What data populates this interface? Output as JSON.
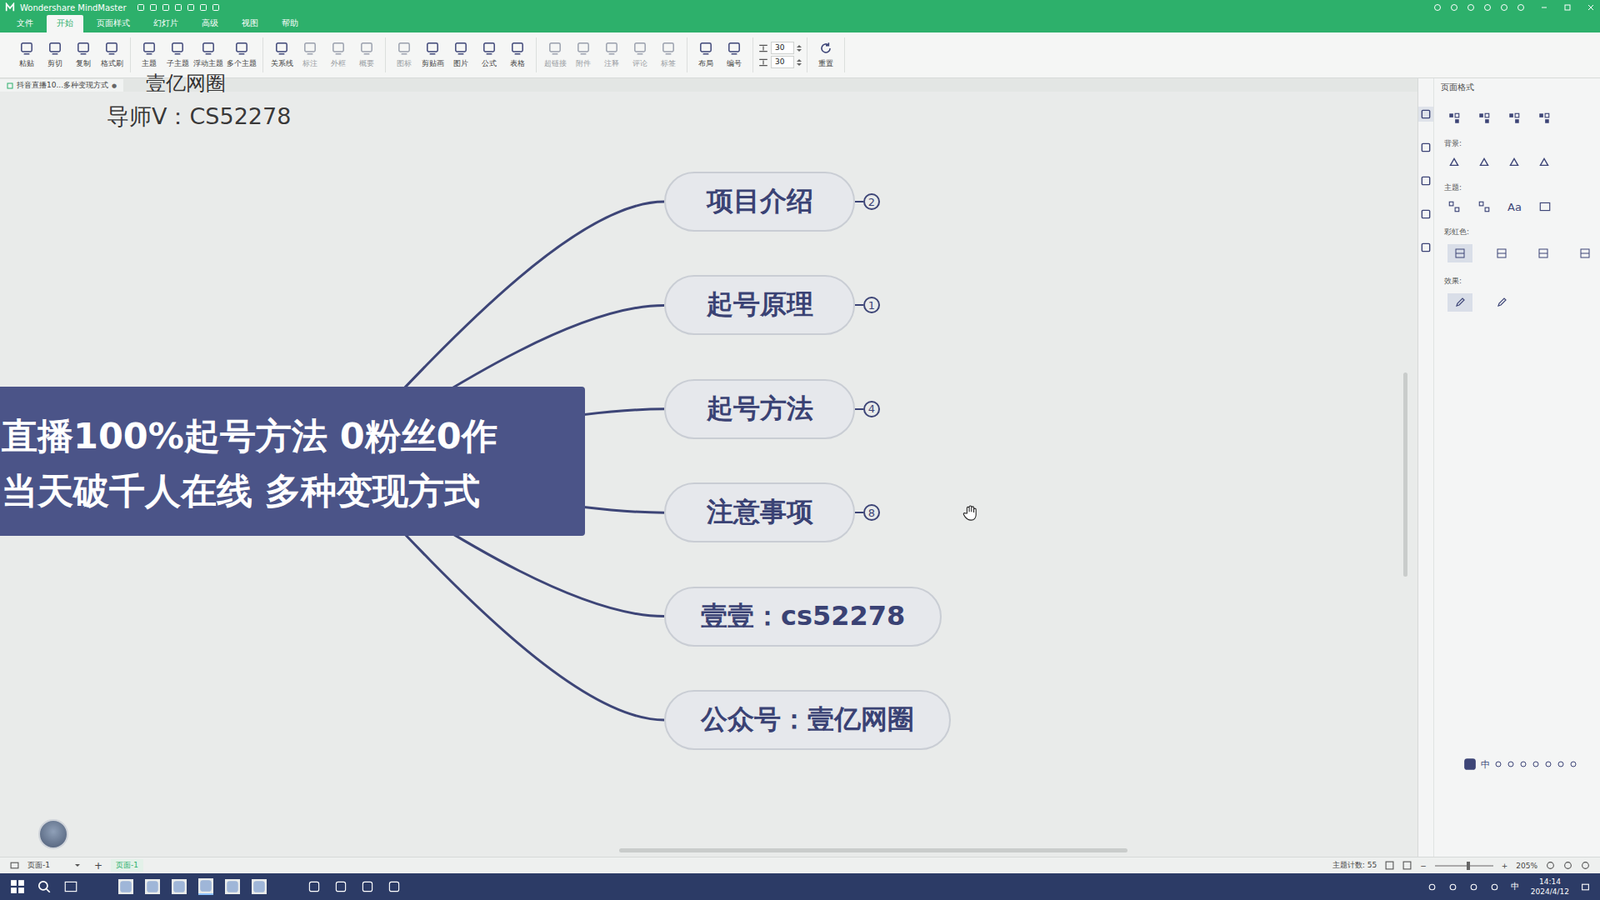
{
  "window": {
    "title": "Wondershare MindMaster"
  },
  "menu_tabs": [
    {
      "label": "文件",
      "selected": false
    },
    {
      "label": "开始",
      "selected": true
    },
    {
      "label": "页面样式",
      "selected": false
    },
    {
      "label": "幻灯片",
      "selected": false
    },
    {
      "label": "高级",
      "selected": false
    },
    {
      "label": "视图",
      "selected": false
    },
    {
      "label": "帮助",
      "selected": false
    }
  ],
  "toolbar": {
    "groups": [
      [
        {
          "label": "粘贴",
          "disabled": false
        },
        {
          "label": "剪切",
          "disabled": false
        },
        {
          "label": "复制",
          "disabled": false
        },
        {
          "label": "格式刷",
          "disabled": false
        }
      ],
      [
        {
          "label": "主题",
          "disabled": false
        },
        {
          "label": "子主题",
          "disabled": false
        },
        {
          "label": "浮动主题",
          "disabled": false
        },
        {
          "label": "多个主题",
          "disabled": false
        }
      ],
      [
        {
          "label": "关系线",
          "disabled": false
        },
        {
          "label": "标注",
          "disabled": true
        },
        {
          "label": "外框",
          "disabled": true
        },
        {
          "label": "概要",
          "disabled": true
        }
      ],
      [
        {
          "label": "图标",
          "disabled": true
        },
        {
          "label": "剪贴画",
          "disabled": false
        },
        {
          "label": "图片",
          "disabled": false
        },
        {
          "label": "公式",
          "disabled": false
        },
        {
          "label": "表格",
          "disabled": false
        }
      ],
      [
        {
          "label": "超链接",
          "disabled": true
        },
        {
          "label": "附件",
          "disabled": true
        },
        {
          "label": "注释",
          "disabled": true
        },
        {
          "label": "评论",
          "disabled": true
        },
        {
          "label": "标签",
          "disabled": true
        }
      ],
      [
        {
          "label": "布局",
          "disabled": false
        },
        {
          "label": "编号",
          "disabled": false
        }
      ]
    ],
    "spinners": [
      {
        "value": "30"
      },
      {
        "value": "30"
      }
    ],
    "reset": {
      "label": "重置"
    }
  },
  "document_tab": {
    "label": "抖音直播10...多种变现方式",
    "modified_mark": "●"
  },
  "watermark": {
    "brand": "壹亿网圈",
    "contact": "导师V：CS52278"
  },
  "mindmap": {
    "central_topic": {
      "lines": [
        "直播100%起号方法 0粉丝0作",
        "当天破千人在线 多种变现方式"
      ]
    },
    "branches": [
      {
        "label": "项目介绍",
        "count": "2"
      },
      {
        "label": "起号原理",
        "count": "1"
      },
      {
        "label": "起号方法",
        "count": "4"
      },
      {
        "label": "注意事项",
        "count": "8"
      },
      {
        "label": "壹壹：cs52278"
      },
      {
        "label": "公众号：壹亿网圈"
      }
    ]
  },
  "right_panel": {
    "title": "页面格式",
    "pin": "ᵖ",
    "background_label": "背景:",
    "theme_label": "主题:",
    "font_button": "Aa",
    "rainbow_label": "彩虹色:",
    "rainbow_options": [
      {
        "selected": true
      },
      {
        "selected": false
      },
      {
        "selected": false
      },
      {
        "selected": false
      }
    ],
    "effect_label": "效果:",
    "effect_options": [
      {
        "selected": true
      },
      {
        "selected": false
      }
    ]
  },
  "ime_bar": {
    "label": "中"
  },
  "status_bar": {
    "page_select": "页面-1",
    "add": "+",
    "page_tab": "页面-1",
    "topic_count": "主题计数: 55",
    "zoom_out": "−",
    "zoom_in": "+",
    "zoom_level": 0.55,
    "zoom": "205%"
  },
  "taskbar": {
    "ime": "中",
    "time": "14:14",
    "date": "2024/4/12"
  }
}
